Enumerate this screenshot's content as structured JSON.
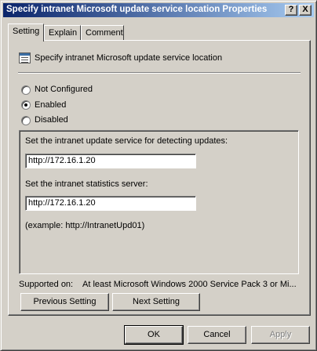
{
  "window": {
    "title": "Specify intranet Microsoft update service location Properties",
    "help_label": "?",
    "close_label": "X"
  },
  "tabs": [
    {
      "label": "Setting",
      "active": true
    },
    {
      "label": "Explain",
      "active": false
    },
    {
      "label": "Comment",
      "active": false
    }
  ],
  "policy": {
    "icon": "policy-icon",
    "name": "Specify intranet Microsoft update service location"
  },
  "radios": [
    {
      "label": "Not Configured",
      "selected": false
    },
    {
      "label": "Enabled",
      "selected": true
    },
    {
      "label": "Disabled",
      "selected": false
    }
  ],
  "options": {
    "update_service_label": "Set the intranet update service for detecting updates:",
    "update_service_value": "http://172.16.1.20",
    "statistics_server_label": "Set the intranet statistics server:",
    "statistics_server_value": "http://172.16.1.20",
    "example_text": "(example: http://IntranetUpd01)"
  },
  "supported": {
    "label": "Supported on:",
    "value": "At least Microsoft Windows 2000 Service Pack 3 or Mi..."
  },
  "nav_buttons": {
    "previous": "Previous Setting",
    "next": "Next Setting"
  },
  "dialog_buttons": {
    "ok": "OK",
    "cancel": "Cancel",
    "apply": "Apply",
    "apply_disabled": true
  },
  "colors": {
    "titlebar_start": "#0a246a",
    "titlebar_end": "#a6caf0",
    "face": "#d4d0c8"
  }
}
